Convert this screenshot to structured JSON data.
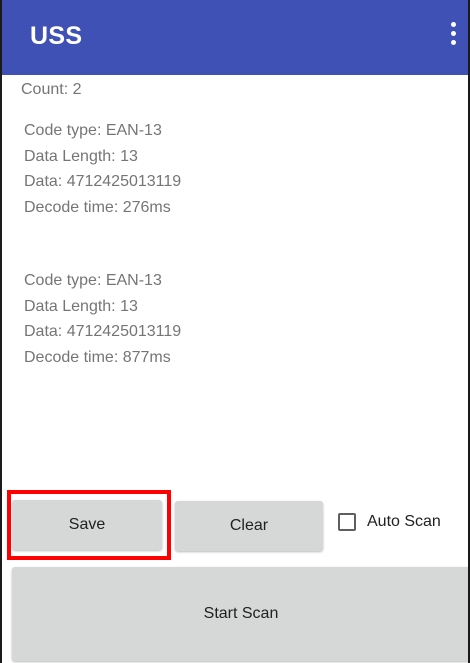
{
  "app_bar": {
    "title": "USS",
    "menu_icon": "overflow-menu-icon",
    "background_color": "#3f51b5"
  },
  "count": {
    "label": "Count:  2"
  },
  "results": [
    {
      "code_type": "Code type: EAN-13",
      "data_length": "Data Length: 13",
      "data": "Data: 4712425013119",
      "decode_time": "Decode time: 276ms"
    },
    {
      "code_type": "Code type: EAN-13",
      "data_length": "Data Length: 13",
      "data": "Data: 4712425013119",
      "decode_time": "Decode time: 877ms"
    }
  ],
  "buttons": {
    "save": "Save",
    "clear": "Clear",
    "start_scan": "Start Scan"
  },
  "auto_scan": {
    "label": "Auto Scan",
    "checked": false
  },
  "highlight_color": "#ff0000"
}
